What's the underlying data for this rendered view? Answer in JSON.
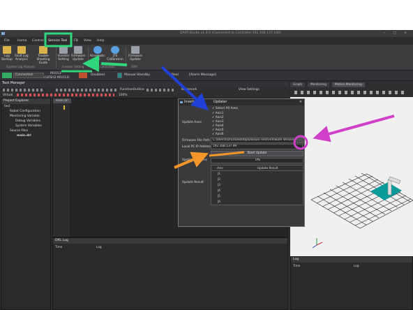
{
  "window": {
    "title": "DART-Studio v1.0.0 (Connected to Controller:192.168.137.100)",
    "controls": "– □ ×"
  },
  "menu": [
    "File",
    "Home",
    "Control",
    "Service Tool",
    "FB",
    "View",
    "Help"
  ],
  "ribbon": {
    "buttons": [
      {
        "l1": "Log",
        "l2": "Backup",
        "icon": "folder-icon",
        "color": "#d9b24a"
      },
      {
        "l1": "Fault Log",
        "l2": "Analysis",
        "icon": "document-icon",
        "color": "#d9b24a"
      },
      {
        "l1": "Trouble",
        "l2": "Shooting Guide",
        "icon": "document-icon",
        "color": "#d9b24a"
      },
      {
        "l1": "Inverter",
        "l2": "Setting",
        "icon": "inverter-icon",
        "color": "#9aa0a8"
      },
      {
        "l1": "Firmware",
        "l2": "Update",
        "icon": "firmware-icon",
        "color": "#9aa0a8"
      },
      {
        "l1": "Kinematic",
        "l2": "Cal.",
        "icon": "kinematic-icon",
        "color": "#5aa0e0"
      },
      {
        "l1": "JTS",
        "l2": "Calibration",
        "icon": "jts-icon",
        "color": "#5aa0e0"
      },
      {
        "l1": "Firmware",
        "l2": "Update",
        "icon": "firmware-icon",
        "color": "#9aa0a8"
      }
    ],
    "groups": [
      "System Log Analysis",
      "Inverter Setting",
      "Calibration",
      "SVM"
    ]
  },
  "status": {
    "connected": "Connected",
    "model_line1": "M1013",
    "model_line2": "(UZSH2-M1013)",
    "disabled": "Disabled",
    "mode": "Manual Standby",
    "real": "Real",
    "alarm": "[Alarm Message]"
  },
  "task_manager": {
    "title": "Task Manager",
    "virtual": "Virtual",
    "zoom": "100%",
    "function_outline": "FunctionOutline",
    "bookmark": "Bookmark",
    "view_settings": "View Settings"
  },
  "project_explorer": {
    "title": "Project Explorer",
    "items": [
      "test",
      "Robot Configuration",
      "Monitoring Variable",
      "Debug Variables",
      "System Variables",
      "Source Files",
      "main.drl"
    ]
  },
  "editor_tab": "main.drl",
  "right_tabs": [
    "Graph",
    "Monitoring",
    "Motion Monitoring"
  ],
  "dialog": {
    "tab1": "Inverter Fir",
    "tab2": "Updater",
    "update_axes_label": "Update Axes",
    "axes_checks": [
      "Select All Axes",
      "Axis1",
      "Axis2",
      "Axis3",
      "Axis4",
      "Axis5",
      "Axis6"
    ],
    "firmware_path_label": "Firmware File Path",
    "firmware_path_value": "C:\\Users\\szruz\\Desktop\\Doosan Files\\Firmware Version",
    "browse": "...",
    "local_ip_label": "Local PC IP Address",
    "local_ip_value": "192.168.137.99",
    "start_update": "Start Update",
    "progress_label": "Update Progress",
    "progress_value": "0%",
    "progress": 0,
    "result_label": "Update Result",
    "result_col_axis": "Axis",
    "result_col_result": "Update Result",
    "result_rows": [
      "J1",
      "J2",
      "J3",
      "J4",
      "J5",
      "J6"
    ]
  },
  "drl_log": {
    "title": "DRL Log",
    "col_time": "Time",
    "col_log": "Log"
  },
  "log_panel": {
    "title": "Log",
    "col_time": "Time",
    "col_log": "Log"
  },
  "colors": {
    "highlight_green": "#2fd67c",
    "arrow_blue": "#2040d8",
    "arrow_orange": "#f2962a",
    "circle_magenta": "#d040c8",
    "teal_base": "#0a9a9a"
  }
}
